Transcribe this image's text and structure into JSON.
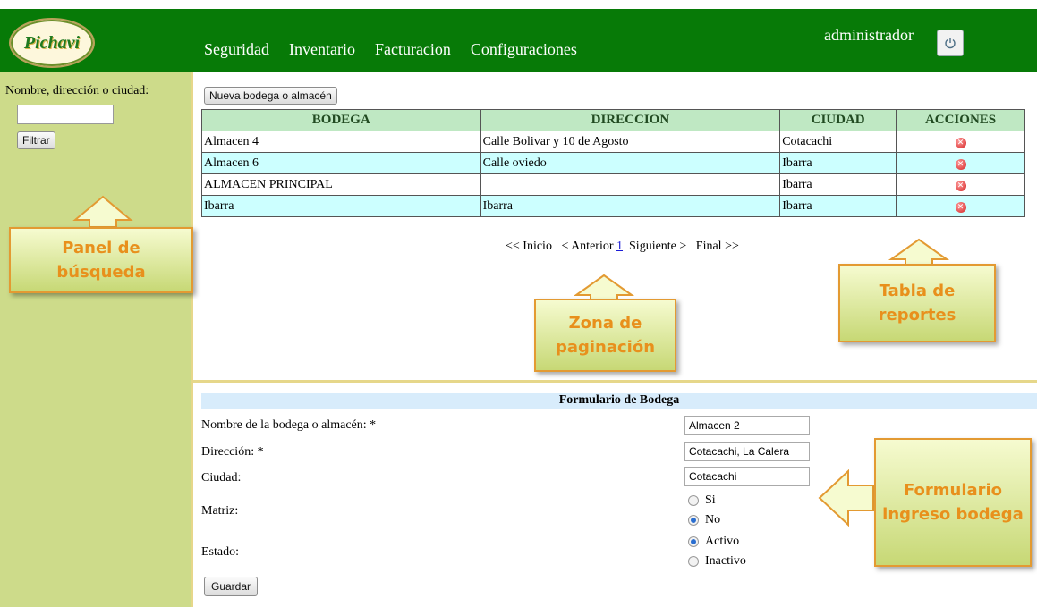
{
  "app": {
    "logo_text": "Pichavi"
  },
  "menu": [
    "Seguridad",
    "Inventario",
    "Facturacion",
    "Configuraciones"
  ],
  "user": {
    "name": "administrador",
    "logout_icon": "power-icon"
  },
  "sidebar": {
    "search_label": "Nombre, dirección o ciudad:",
    "search_value": "",
    "filter_button": "Filtrar"
  },
  "toolbar": {
    "new_button": "Nueva bodega o almacén"
  },
  "table": {
    "headers": [
      "BODEGA",
      "DIRECCION",
      "CIUDAD",
      "ACCIONES"
    ],
    "rows": [
      {
        "bodega": "Almacen 4",
        "direccion": "Calle Bolivar y 10 de Agosto",
        "ciudad": "Cotacachi"
      },
      {
        "bodega": "Almacen 6",
        "direccion": "Calle oviedo",
        "ciudad": "Ibarra"
      },
      {
        "bodega": "ALMACEN PRINCIPAL",
        "direccion": "",
        "ciudad": "Ibarra"
      },
      {
        "bodega": "Ibarra",
        "direccion": "Ibarra",
        "ciudad": "Ibarra"
      }
    ],
    "delete_icon": "delete-icon"
  },
  "pager": {
    "first": "<< Inicio",
    "prev": "< Anterior",
    "current": "1",
    "next": "Siguiente >",
    "last": "Final >>"
  },
  "form": {
    "title": "Formulario de Bodega",
    "name_label": "Nombre de la bodega o almacén: *",
    "name_value": "Almacen 2",
    "address_label": "Dirección: *",
    "address_value": "Cotacachi, La Calera",
    "city_label": "Ciudad:",
    "city_value": "Cotacachi",
    "matriz_label": "Matriz:",
    "matriz_options": [
      "Si",
      "No"
    ],
    "matriz_selected": "No",
    "estado_label": "Estado:",
    "estado_options": [
      "Activo",
      "Inactivo"
    ],
    "estado_selected": "Activo",
    "save_button": "Guardar"
  },
  "annotations": {
    "search_panel": [
      "Panel de",
      "búsqueda"
    ],
    "pagination": [
      "Zona de",
      "paginación"
    ],
    "reports": [
      "Tabla de",
      "reportes"
    ],
    "form": [
      "Formulario",
      "ingreso bodega"
    ]
  },
  "colors": {
    "topbar": "#077a07",
    "sidebar": "#cddb8a",
    "table_header": "#bfe8c3",
    "row_alt": "#ccffff",
    "callout_text": "#e8901c"
  }
}
